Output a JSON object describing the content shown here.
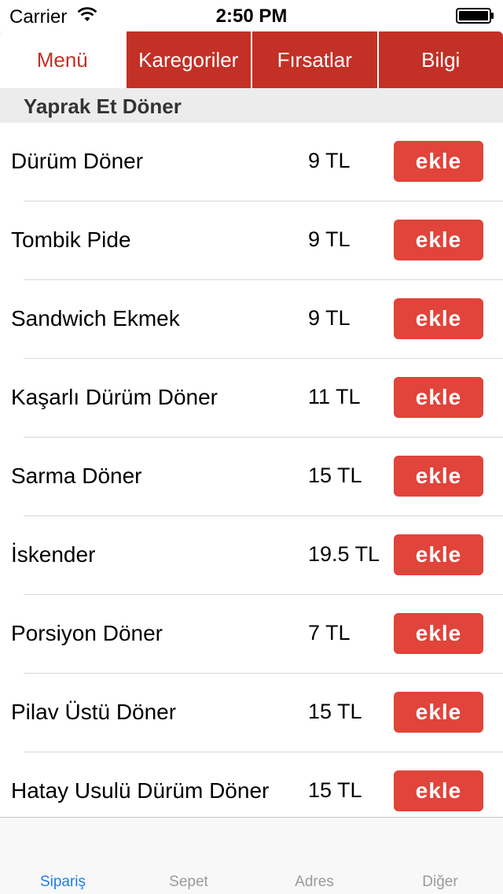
{
  "status_bar": {
    "carrier": "Carrier",
    "time": "2:50 PM"
  },
  "top_tabs": [
    {
      "label": "Menü",
      "active": true
    },
    {
      "label": "Karegoriler",
      "active": false
    },
    {
      "label": "Fırsatlar",
      "active": false
    },
    {
      "label": "Bilgi",
      "active": false
    }
  ],
  "section": {
    "title": "Yaprak Et Döner"
  },
  "items": [
    {
      "name": "Dürüm Döner",
      "price": "9 TL",
      "button": "ekle"
    },
    {
      "name": "Tombik Pide",
      "price": "9 TL",
      "button": "ekle"
    },
    {
      "name": "Sandwich Ekmek",
      "price": "9 TL",
      "button": "ekle"
    },
    {
      "name": "Kaşarlı Dürüm Döner",
      "price": "11 TL",
      "button": "ekle"
    },
    {
      "name": "Sarma Döner",
      "price": "15 TL",
      "button": "ekle"
    },
    {
      "name": "İskender",
      "price": "19.5 TL",
      "button": "ekle"
    },
    {
      "name": "Porsiyon Döner",
      "price": "7 TL",
      "button": "ekle"
    },
    {
      "name": "Pilav Üstü Döner",
      "price": "15 TL",
      "button": "ekle"
    },
    {
      "name": "Hatay Usulü Dürüm Döner",
      "price": "15 TL",
      "button": "ekle"
    }
  ],
  "bottom_tabs": [
    {
      "label": "Sipariş",
      "active": true
    },
    {
      "label": "Sepet",
      "active": false
    },
    {
      "label": "Adres",
      "active": false
    },
    {
      "label": "Diğer",
      "active": false
    }
  ],
  "colors": {
    "accent": "#c33025",
    "button": "#e0443a",
    "tab_active": "#1e7ee6"
  }
}
